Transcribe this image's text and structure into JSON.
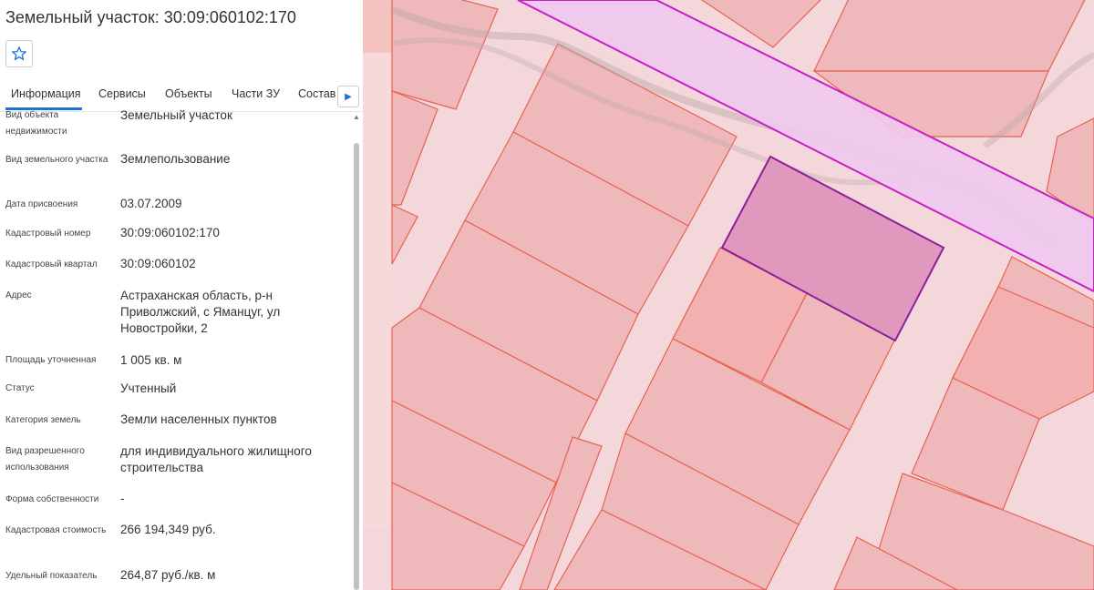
{
  "map": {
    "colors": {
      "background": "#f4d7da",
      "parcel_fill": "#efb9bb",
      "parcel_stroke": "#e8614f",
      "road_fill": "#f3cfd3",
      "zone_fill": "#efc9ee",
      "zone_stroke": "#c81fc8",
      "selected_fill": "#e098bd",
      "selected_stroke": "#8d1f9e"
    }
  },
  "panel": {
    "title": "Земельный участок: 30:09:060102:170",
    "favorite_icon": "star-outline-icon",
    "tabs": [
      {
        "label": "Информация",
        "active": true
      },
      {
        "label": "Сервисы",
        "active": false
      },
      {
        "label": "Объекты",
        "active": false
      },
      {
        "label": "Части ЗУ",
        "active": false
      },
      {
        "label": "Состав",
        "active": false
      }
    ],
    "tab_next_icon": "chevron-right-icon",
    "properties": [
      {
        "label": "Вид объекта недвижимости",
        "value": "Земельный участок"
      },
      {
        "label": "Вид земельного участка",
        "value": "Землепользование"
      },
      {
        "label": "Дата присвоения",
        "value": "03.07.2009"
      },
      {
        "label": "Кадастровый номер",
        "value": "30:09:060102:170"
      },
      {
        "label": "Кадастровый квартал",
        "value": "30:09:060102"
      },
      {
        "label": "Адрес",
        "value": "Астраханская область, р-н Приволжский, с Яманцуг, ул Новостройки, 2"
      },
      {
        "label": "Площадь уточненная",
        "value": "1 005 кв. м"
      },
      {
        "label": "Статус",
        "value": "Учтенный"
      },
      {
        "label": "Категория земель",
        "value": "Земли населенных пунктов"
      },
      {
        "label": "Вид разрешенного использования",
        "value": "для индивидуального жилищного строительства"
      },
      {
        "label": "Форма собственности",
        "value": "-"
      },
      {
        "label": "Кадастровая стоимость",
        "value": "266 194,349 руб."
      },
      {
        "label": "Удельный показатель",
        "value": "264,87 руб./кв. м"
      }
    ]
  }
}
